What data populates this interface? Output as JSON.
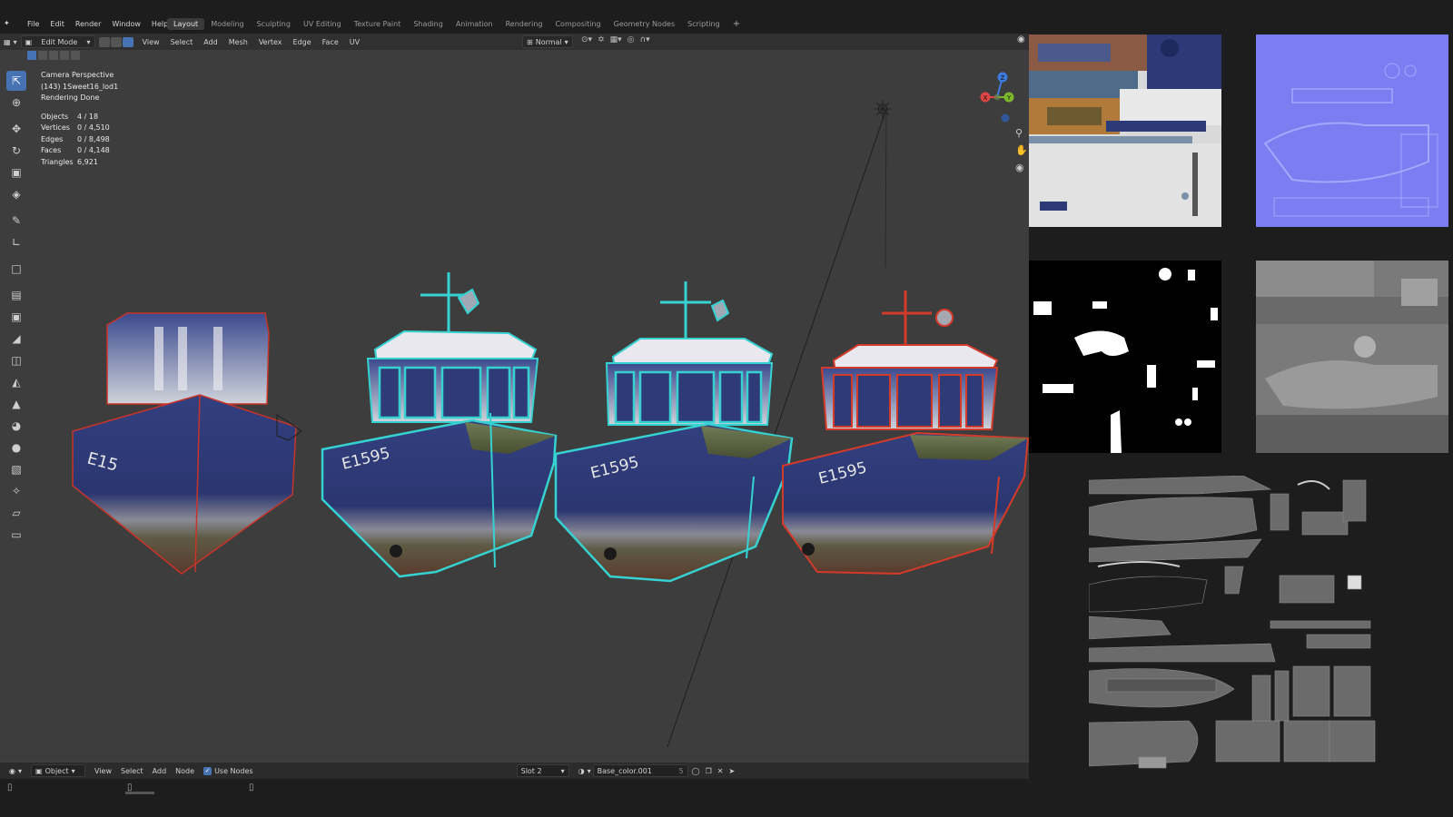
{
  "app": {
    "logo": "blender-logo-icon"
  },
  "menubar": {
    "items": [
      "File",
      "Edit",
      "Render",
      "Window",
      "Help"
    ]
  },
  "workspaces": {
    "tabs": [
      "Layout",
      "Modeling",
      "Sculpting",
      "UV Editing",
      "Texture Paint",
      "Shading",
      "Animation",
      "Rendering",
      "Compositing",
      "Geometry Nodes",
      "Scripting"
    ],
    "active": "Layout",
    "add": "+"
  },
  "header3d": {
    "mode": "Edit Mode",
    "menus": [
      "View",
      "Select",
      "Add",
      "Mesh",
      "Vertex",
      "Edge",
      "Face",
      "UV"
    ],
    "pivot": "Normal"
  },
  "viewport": {
    "camera": "Camera Perspective",
    "object": "(143) 1Sweet16_lod1",
    "status": "Rendering Done",
    "stats": [
      {
        "k": "Objects",
        "v": "4 / 18"
      },
      {
        "k": "Vertices",
        "v": "0 / 4,510"
      },
      {
        "k": "Edges",
        "v": "0 / 8,498"
      },
      {
        "k": "Faces",
        "v": "0 / 4,148"
      },
      {
        "k": "Triangles",
        "v": "6,921"
      }
    ],
    "hull_text": "E1595",
    "gizmo": {
      "x": "X",
      "y": "Y",
      "z": "Z"
    }
  },
  "node_header": {
    "object": "Object",
    "menus": [
      "View",
      "Select",
      "Add",
      "Node"
    ],
    "use_nodes": "Use Nodes",
    "slot": "Slot 2",
    "material": "Base_color.001",
    "users": "5"
  },
  "colors": {
    "accent": "#4772b3",
    "selected_cyan": "#36d1d1",
    "selected_red": "#d43a2a",
    "viewport_bg": "#3d3d3d",
    "hull_blue": "#2e3a7a"
  }
}
